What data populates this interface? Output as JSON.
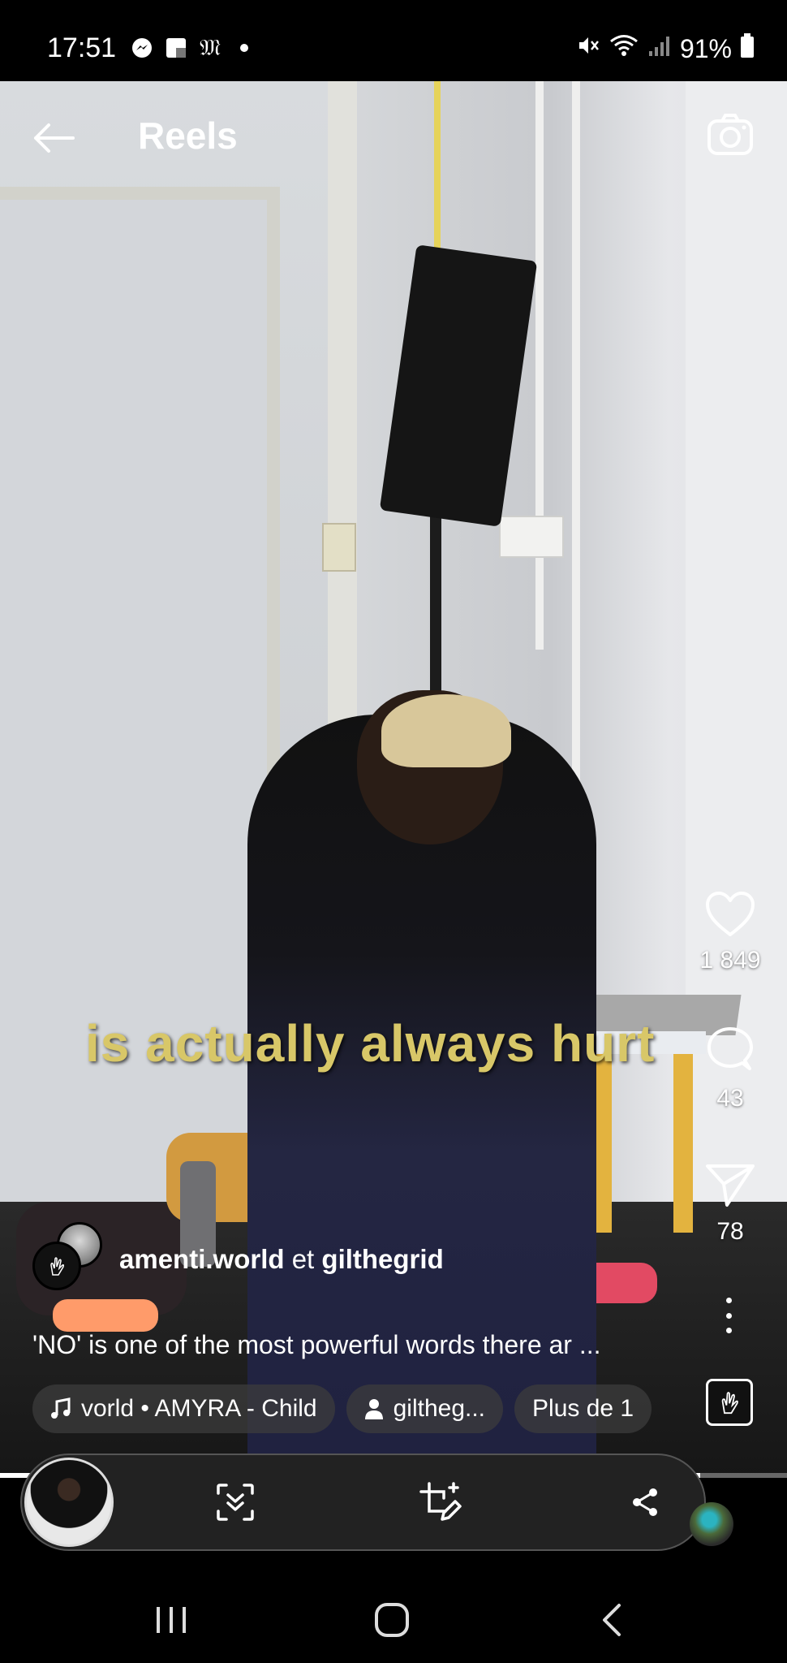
{
  "status_bar": {
    "time": "17:51",
    "battery": "91%",
    "left_icons": [
      "messenger-icon",
      "app-icon",
      "gothic-m-icon",
      "dot"
    ],
    "right_icons": [
      "mute-icon",
      "wifi-icon",
      "signal-icon",
      "battery-icon"
    ]
  },
  "header": {
    "title": "Reels",
    "back_icon": "back-arrow-icon",
    "camera_icon": "camera-icon"
  },
  "video": {
    "caption_overlay": "is actually always hurt"
  },
  "actions": {
    "like_count": "1 849",
    "comment_count": "43",
    "share_count": "78"
  },
  "author": {
    "username": "amenti.world",
    "conjunction": "et",
    "collaborator": "gilthegrid"
  },
  "description": "'NO' is one of the most powerful words there ar ...",
  "chips": {
    "audio": "vorld • AMYRA - Child",
    "tagged": "giltheg...",
    "more": "Plus de 1"
  },
  "progress": {
    "fraction": 0.89
  },
  "colors": {
    "caption_yellow": "#d8c768",
    "chip_bg": "#3c3c3c",
    "toolbar_bg": "#222222"
  }
}
